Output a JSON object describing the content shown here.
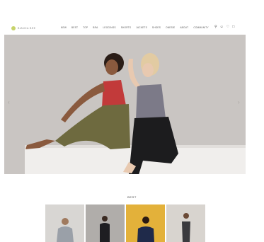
{
  "brand": {
    "logo_text": "BIANCA BEE",
    "logo_color": "#c7d36a"
  },
  "nav": {
    "items": [
      "NEW",
      "BEST",
      "TOP",
      "BRA",
      "LEGGINGS",
      "SHORTS",
      "JACKETS",
      "SHOES",
      "ONESIE",
      "ABOUT",
      "COMMUNITY"
    ]
  },
  "utilities": {
    "icons": [
      "search-icon",
      "user-icon",
      "heart-icon",
      "bag-icon"
    ]
  },
  "hero": {
    "background": "#c9c5c2",
    "slider_prev_icon": "‹",
    "slider_next_icon": "›"
  },
  "best": {
    "title": "BEST",
    "products": [
      {
        "name": "product-card-1",
        "bg": "#d8d6d3",
        "apparel": "#9aa0a8"
      },
      {
        "name": "product-card-2",
        "bg": "#b0adaa",
        "apparel": "#1e1e22"
      },
      {
        "name": "product-card-3",
        "bg": "#e3b13a",
        "apparel": "#1f2a4a"
      },
      {
        "name": "product-card-4",
        "bg": "#d8d4cf",
        "apparel": "#3a3a3e"
      }
    ]
  }
}
